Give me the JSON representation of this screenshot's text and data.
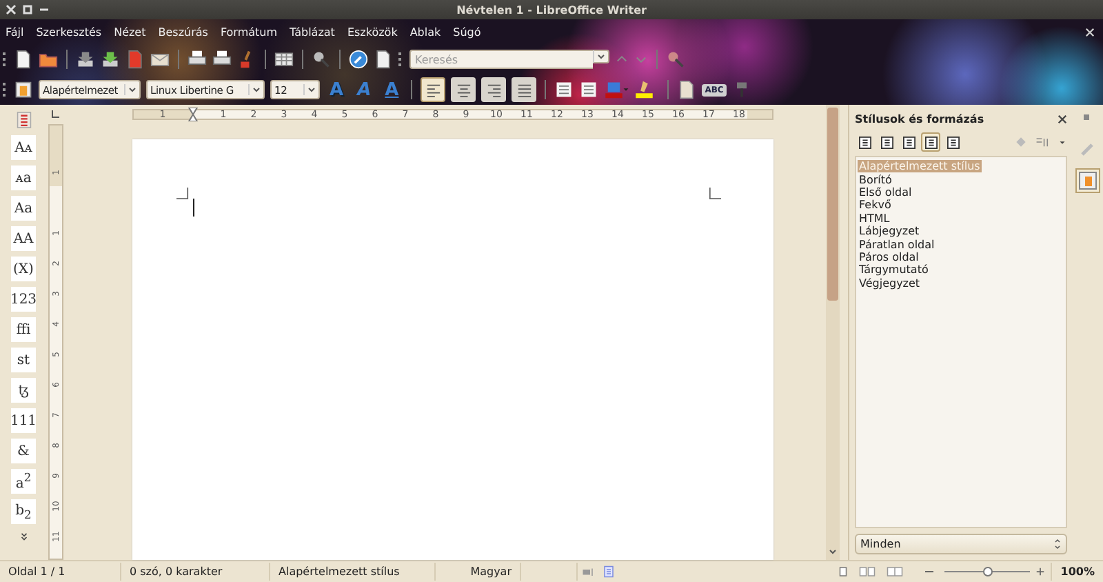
{
  "window": {
    "title": "Névtelen 1 - LibreOffice Writer"
  },
  "menu": [
    "Fájl",
    "Szerkesztés",
    "Nézet",
    "Beszúrás",
    "Formátum",
    "Táblázat",
    "Eszközök",
    "Ablak",
    "Súgó"
  ],
  "search": {
    "placeholder": "Keresés"
  },
  "format_bar": {
    "style": "Alapértelmezet",
    "font": "Linux Libertine G",
    "size": "12",
    "effects": [
      {
        "kind": "shadow",
        "label": "A"
      },
      {
        "kind": "italic",
        "label": "A"
      },
      {
        "kind": "underline",
        "label": "A"
      }
    ],
    "alignment": [
      {
        "selected": true
      },
      {
        "selected": false
      },
      {
        "selected": false
      },
      {
        "selected": false
      }
    ],
    "spellcheck": "ABC"
  },
  "ruler": {
    "horizontal": [
      "1",
      "1",
      "2",
      "3",
      "4",
      "5",
      "6",
      "7",
      "8",
      "9",
      "10",
      "11",
      "12",
      "13",
      "14",
      "15",
      "16",
      "17",
      "18"
    ],
    "vertical": [
      "1",
      "1",
      "2",
      "3",
      "4",
      "5",
      "6",
      "7",
      "8",
      "9",
      "10",
      "11"
    ]
  },
  "glyphs": [
    "Aᴀ",
    "ᴀa",
    "Aa",
    "AA",
    "(X)",
    "123",
    "ffi",
    "st",
    "ꜩ",
    "111",
    "&",
    "a$^{2}$",
    "b$_{2}$"
  ],
  "styles_panel": {
    "title": "Stílusok és formázás",
    "categories": [
      {
        "selected": false
      },
      {
        "selected": false
      },
      {
        "selected": false
      },
      {
        "selected": true
      },
      {
        "selected": false
      }
    ],
    "items": [
      {
        "label": "Alapértelmezett stílus",
        "selected": true
      },
      {
        "label": "Borító",
        "selected": false
      },
      {
        "label": "Első oldal",
        "selected": false
      },
      {
        "label": "Fekvő",
        "selected": false
      },
      {
        "label": "HTML",
        "selected": false
      },
      {
        "label": "Lábjegyzet",
        "selected": false
      },
      {
        "label": "Páratlan oldal",
        "selected": false
      },
      {
        "label": "Páros oldal",
        "selected": false
      },
      {
        "label": "Tárgymutató",
        "selected": false
      },
      {
        "label": "Végjegyzet",
        "selected": false
      }
    ],
    "filter": "Minden"
  },
  "status_bar": {
    "page": "Oldal 1 / 1",
    "words": "0 szó, 0 karakter",
    "style": "Alapértelmezett stílus",
    "language": "Magyar",
    "zoom": {
      "level": 0.5
    },
    "zoom_label": "100%"
  }
}
